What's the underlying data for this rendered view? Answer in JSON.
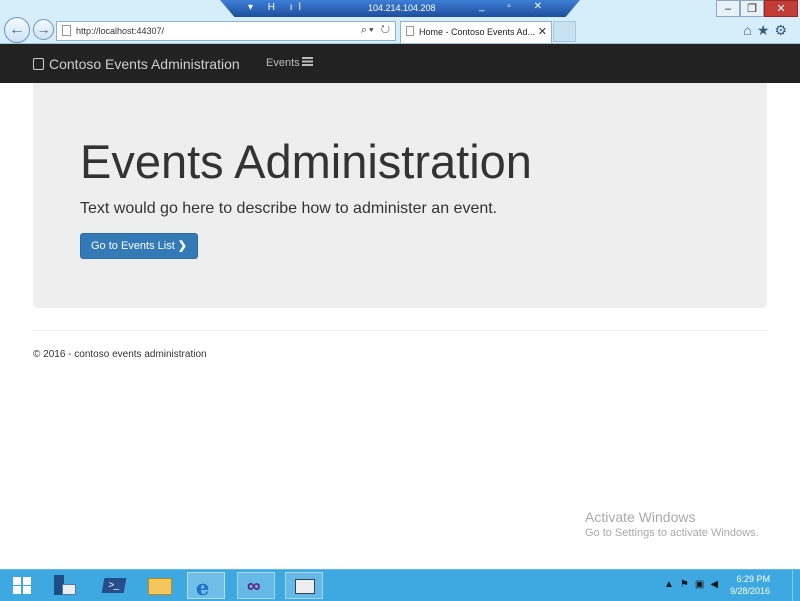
{
  "browser": {
    "remote_host": "104.214.104.208",
    "address_url": "http://localhost:44307/",
    "tab_title": "Home - Contoso Events Ad...",
    "window_controls": [
      "minimize",
      "restore",
      "close"
    ]
  },
  "navbar": {
    "brand": "Contoso Events Administration",
    "items": [
      {
        "label": "Events"
      }
    ]
  },
  "jumbotron": {
    "heading": "Events Administration",
    "lead": "Text would go here to describe how to administer an event.",
    "button_label": "Go to Events List",
    "button_color": "#337ab7"
  },
  "footer": {
    "text": "© 2016 - contoso events administration"
  },
  "watermark": {
    "title": "Activate Windows",
    "subtitle": "Go to Settings to activate Windows."
  },
  "taskbar": {
    "pinned": [
      "windows-start",
      "server-manager",
      "powershell",
      "file-explorer",
      "internet-explorer",
      "visual-studio",
      "app-window"
    ],
    "clock_time": "6:29 PM",
    "clock_date": "9/28/2016"
  },
  "colors": {
    "navbar_bg": "#222222",
    "jumbotron_bg": "#eeeeee",
    "taskbar_bg": "#3ea8e0"
  }
}
